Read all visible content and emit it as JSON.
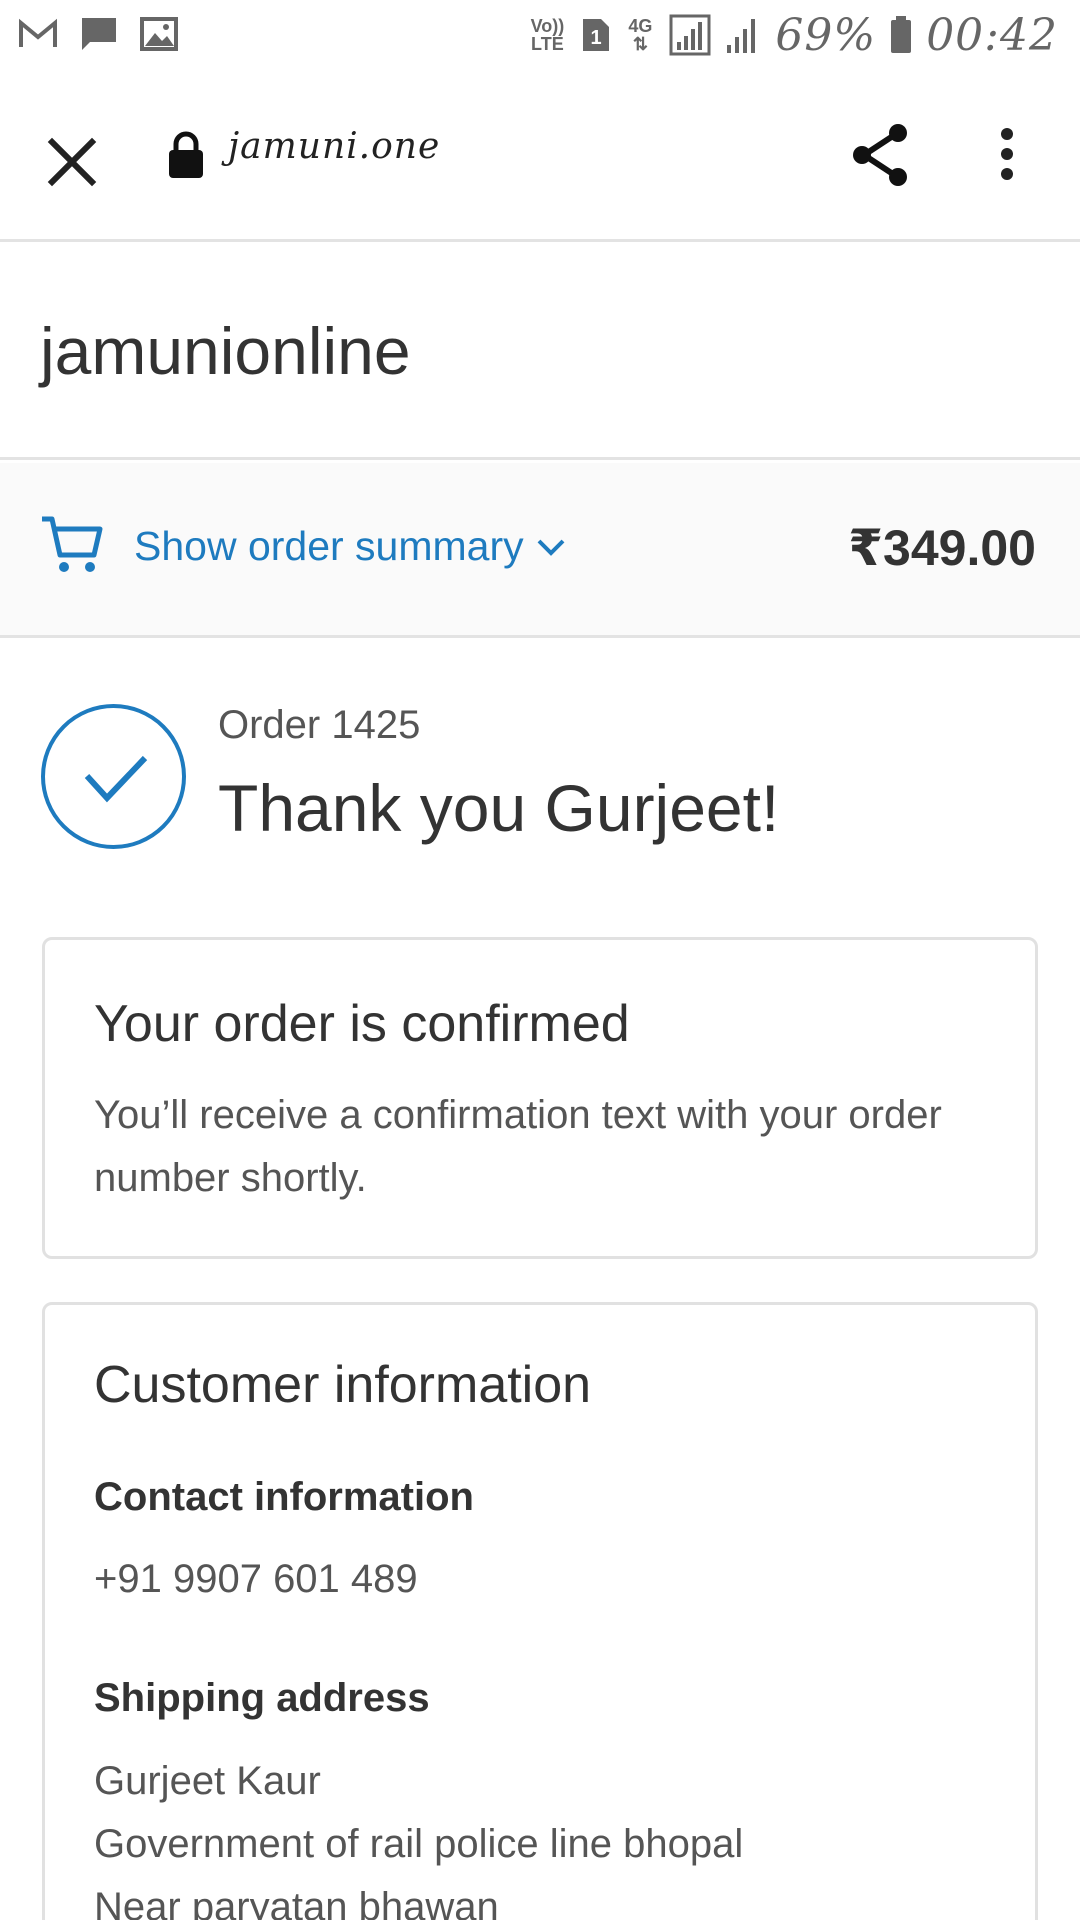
{
  "status_bar": {
    "battery": "69%",
    "time": "00:42",
    "network": "4G",
    "sim": "1",
    "volte": "Vo)) LTE",
    "icons": [
      "gmail-icon",
      "message-icon",
      "image-icon",
      "volte-icon",
      "sim-icon",
      "data-icon",
      "signal-icon",
      "signal-icon",
      "battery-icon"
    ]
  },
  "browser": {
    "url": "jamuni.one",
    "icons": [
      "close-icon",
      "lock-icon",
      "share-icon",
      "more-vert-icon"
    ]
  },
  "store": {
    "name": "jamunionline"
  },
  "summary": {
    "toggle_label": "Show order summary",
    "total": "₹349.00",
    "accent_color": "#1e7bbf"
  },
  "order": {
    "number": "Order 1425",
    "thank_you": "Thank you Gurjeet!"
  },
  "confirmation": {
    "title": "Your order is confirmed",
    "text": "You’ll receive a confirmation text with your order number shortly."
  },
  "customer": {
    "title": "Customer information",
    "contact_label": "Contact information",
    "phone": "+91 9907 601 489",
    "shipping_label": "Shipping address",
    "address": [
      "Gurjeet Kaur",
      "Government of rail police line bhopal",
      "Near paryatan bhawan"
    ]
  }
}
